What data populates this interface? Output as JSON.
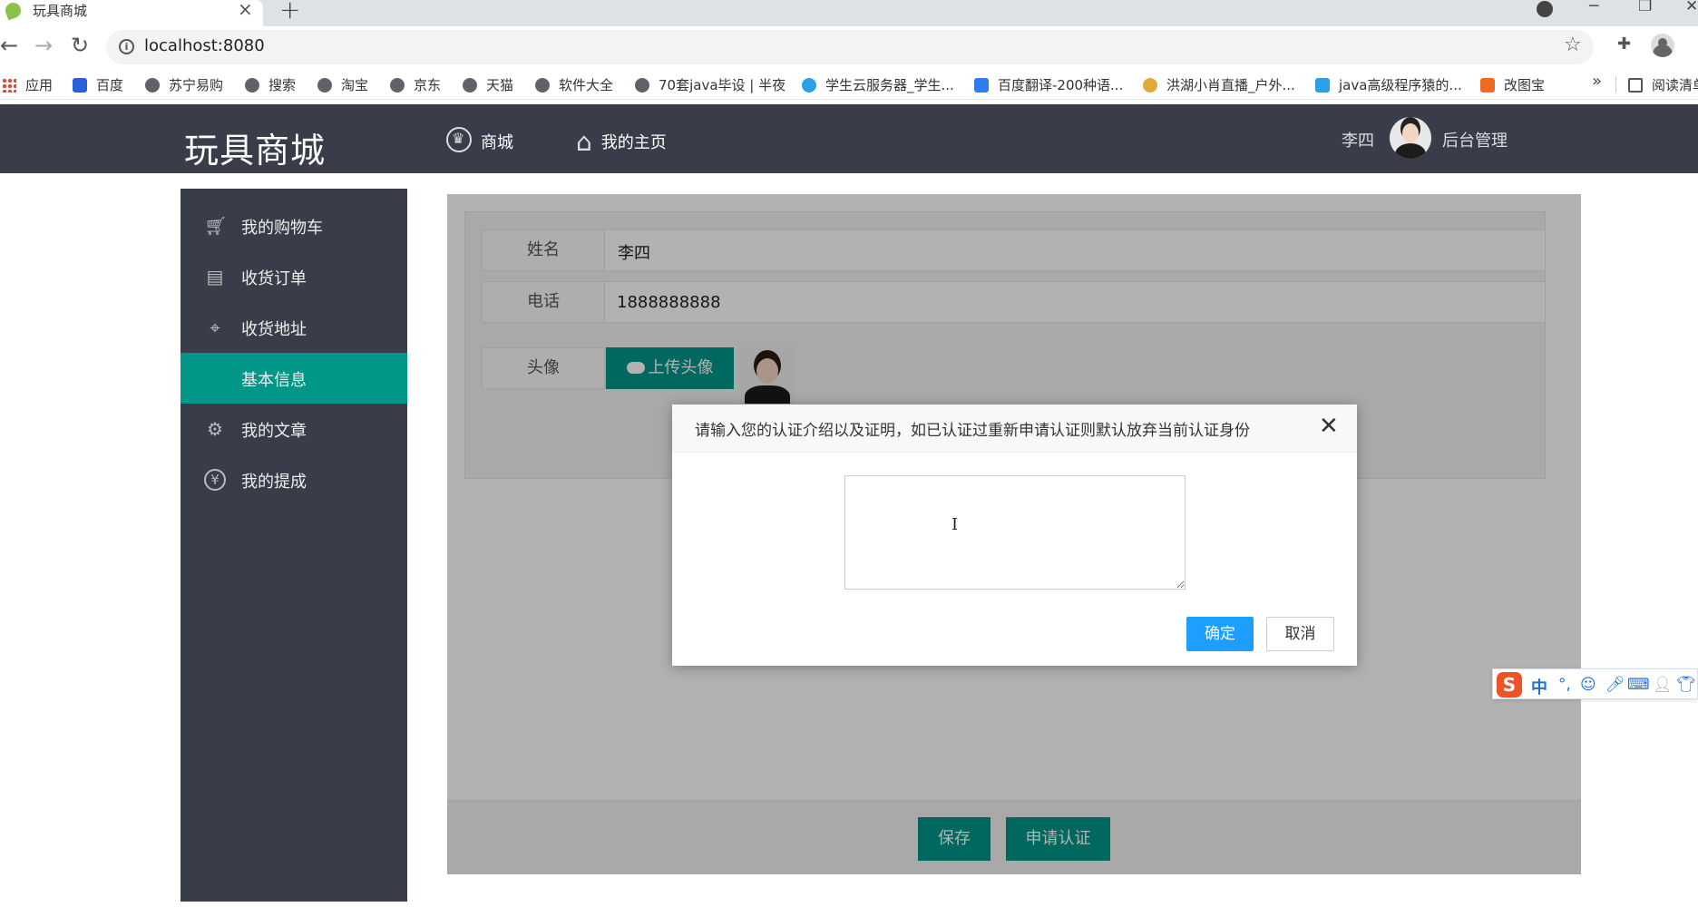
{
  "browser": {
    "tab_title": "玩具商城",
    "url": "localhost:8080",
    "bookmarks": {
      "apps": "应用",
      "b1": "百度",
      "b2": "苏宁易购",
      "b3": "搜索",
      "b4": "淘宝",
      "b5": "京东",
      "b6": "天猫",
      "b7": "软件大全",
      "b8": "70套java毕设 | 半夜",
      "b9": "学生云服务器_学生...",
      "b10": "百度翻译-200种语...",
      "b11": "洪湖小肖直播_户外...",
      "b12": "java高级程序猿的...",
      "b13": "改图宝",
      "reading": "阅读清单"
    }
  },
  "header": {
    "logo": "玩具商城",
    "nav_mall": "商城",
    "nav_home": "我的主页",
    "user_name": "李四",
    "admin": "后台管理"
  },
  "sidebar": {
    "items": [
      {
        "label": "我的购物车",
        "icon": "cart-icon"
      },
      {
        "label": "收货订单",
        "icon": "document-icon"
      },
      {
        "label": "收货地址",
        "icon": "location-icon"
      },
      {
        "label": "基本信息",
        "icon": ""
      },
      {
        "label": "我的文章",
        "icon": "gear-icon"
      },
      {
        "label": "我的提成",
        "icon": "yen-icon"
      }
    ],
    "active_index": 3
  },
  "form": {
    "name_label": "姓名",
    "name_value": "李四",
    "phone_label": "电话",
    "phone_value": "1888888888",
    "avatar_label": "头像",
    "upload_button": "上传头像",
    "save_button": "保存",
    "apply_button": "申请认证"
  },
  "dialog": {
    "title": "请输入您的认证介绍以及证明，如已认证过重新申请认证则默认放弃当前认证身份",
    "textarea_value": "",
    "ok_button": "确定",
    "cancel_button": "取消"
  },
  "ime": {
    "logo": "S",
    "mode": "中"
  },
  "colors": {
    "header_bg": "#393d49",
    "primary_green": "#009688",
    "dialog_ok_blue": "#1e9fff"
  }
}
